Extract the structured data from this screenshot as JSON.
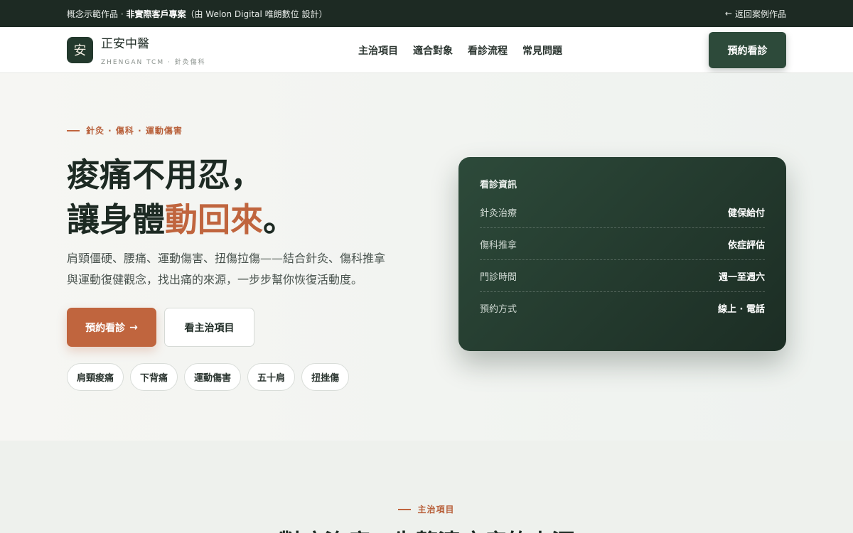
{
  "topbar": {
    "note_prefix": "概念示範作品 · ",
    "note_strong": "非實際客戶專案",
    "note_suffix": "（由 Welon Digital 唯朗數位 設計）",
    "back_label": "返回案例作品",
    "back_icon": "arrow-left-icon"
  },
  "brand": {
    "logo_char": "安",
    "name": "正安中醫",
    "subtitle": "ZHENGAN TCM · 針灸傷科"
  },
  "nav": {
    "items": [
      "主治項目",
      "適合對象",
      "看診流程",
      "常見問題"
    ],
    "cta": "預約看診"
  },
  "hero": {
    "eyebrow": "針灸 · 傷科 · 運動傷害",
    "headline_line1": "痠痛不用忍，",
    "headline_line2_a": "讓身體",
    "headline_line2_accent": "動回來",
    "headline_line2_b": "。",
    "description": "肩頸僵硬、腰痛、運動傷害、扭傷拉傷——結合針灸、傷科推拿與運動復健觀念，找出痛的來源，一步步幫你恢復活動度。",
    "primary_button": "預約看診",
    "primary_arrow": "→",
    "secondary_button": "看主治項目",
    "tags": [
      "肩頸痠痛",
      "下背痛",
      "運動傷害",
      "五十肩",
      "扭挫傷"
    ]
  },
  "info_card": {
    "title": "看診資訊",
    "rows": [
      {
        "label": "針灸治療",
        "value": "健保給付"
      },
      {
        "label": "傷科推拿",
        "value": "依症評估"
      },
      {
        "label": "門診時間",
        "value": "週一至週六"
      },
      {
        "label": "預約方式",
        "value": "線上 · 電話"
      }
    ]
  },
  "section2": {
    "eyebrow": "主治項目",
    "heading_peek": "對症治療，先釐清疼痛的來源"
  },
  "colors": {
    "dark_green": "#1d2a23",
    "brand_green": "#2d4a3a",
    "accent": "#c0653e"
  }
}
